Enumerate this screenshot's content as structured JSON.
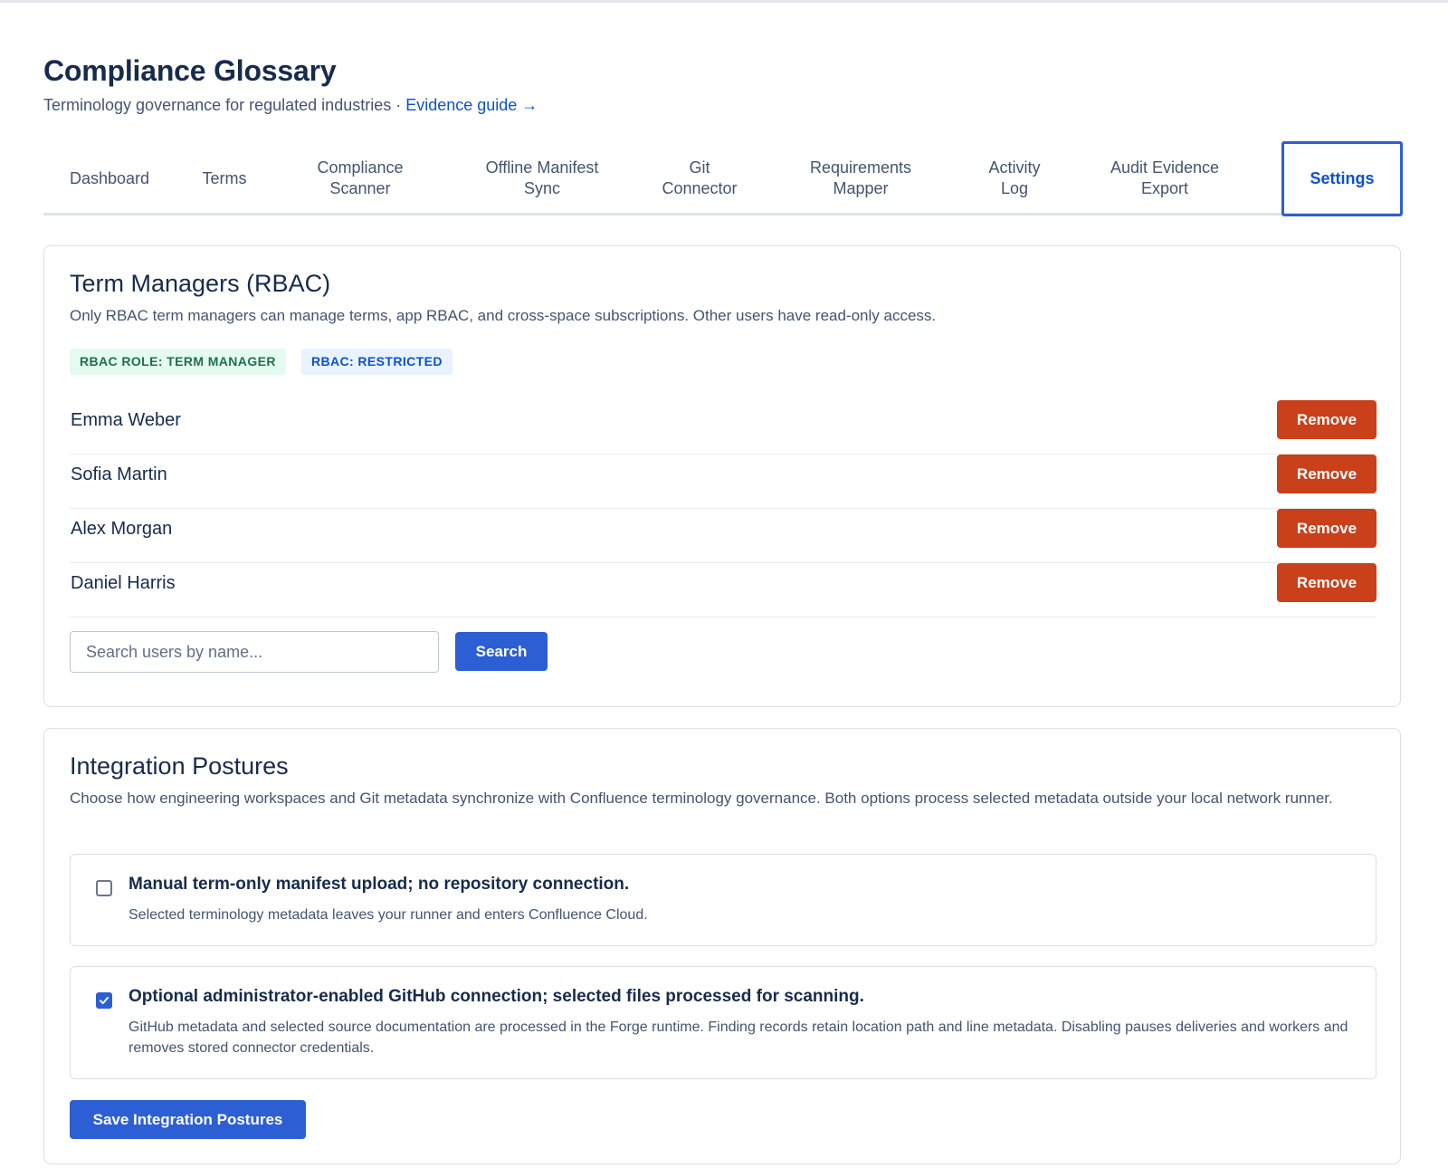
{
  "header": {
    "title": "Compliance Glossary",
    "subtitle": "Terminology governance for regulated industries · ",
    "evidence_link": "Evidence guide →"
  },
  "tabs": [
    {
      "label": "Dashboard"
    },
    {
      "label": "Terms"
    },
    {
      "label": "Compliance\nScanner"
    },
    {
      "label": "Offline Manifest\nSync"
    },
    {
      "label": "Git\nConnector"
    },
    {
      "label": "Requirements\nMapper"
    },
    {
      "label": "Activity\nLog"
    },
    {
      "label": "Audit Evidence\nExport"
    },
    {
      "label": "Settings",
      "active": true
    }
  ],
  "term_managers": {
    "title": "Term Managers (RBAC)",
    "description": "Only RBAC term managers can manage terms, app RBAC, and cross-space subscriptions. Other users have read-only access.",
    "badges": [
      "RBAC ROLE: TERM MANAGER",
      "RBAC: RESTRICTED"
    ],
    "managers": [
      {
        "name": "Emma Weber",
        "action": "Remove"
      },
      {
        "name": "Sofia Martin",
        "action": "Remove"
      },
      {
        "name": "Alex Morgan",
        "action": "Remove"
      },
      {
        "name": "Daniel Harris",
        "action": "Remove"
      }
    ],
    "search_placeholder": "Search users by name...",
    "search_value": "",
    "search_button": "Search"
  },
  "integration": {
    "title": "Integration Postures",
    "description": "Choose how engineering workspaces and Git metadata synchronize with Confluence terminology governance. Both options process selected metadata outside your local network runner.",
    "options": [
      {
        "title": "Manual term-only manifest upload; no repository connection.",
        "description": "Selected terminology metadata leaves your runner and enters Confluence Cloud.",
        "checked": false
      },
      {
        "title": "Optional administrator-enabled GitHub connection; selected files processed for scanning.",
        "description": "GitHub metadata and selected source documentation are processed in the Forge runtime. Finding records retain location path and line metadata. Disabling pauses deliveries and workers and removes stored connector credentials.",
        "checked": true
      }
    ],
    "save_button": "Save Integration Postures"
  },
  "colors": {
    "primary": "#2c5fd4",
    "danger": "#c9401a",
    "text": "#172b4d",
    "muted": "#44546f"
  }
}
